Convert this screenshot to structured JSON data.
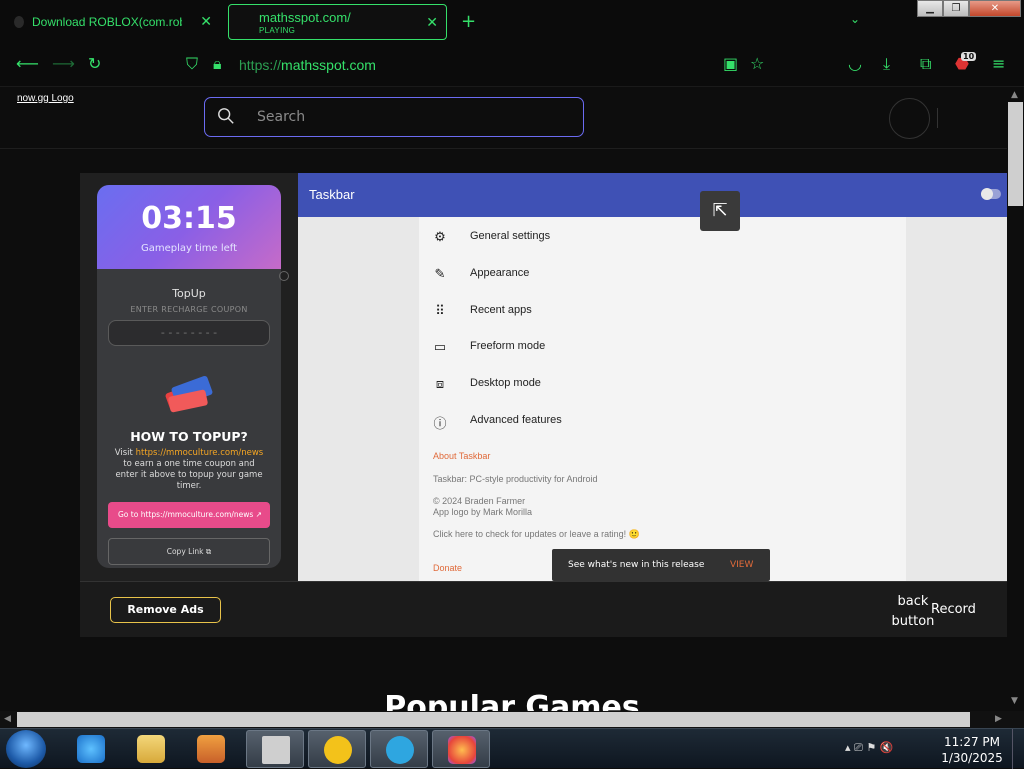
{
  "tabs": [
    {
      "title": "Download ROBLOX(com.roblox",
      "close": "✕"
    },
    {
      "title": "mathsspot.com/",
      "sub": "PLAYING",
      "close": "✕"
    }
  ],
  "newtab": "+",
  "tablist": "⌄",
  "window_controls": {
    "min": "▁",
    "max": "❐",
    "close": "✕"
  },
  "nav": {
    "url_prefix": "https://",
    "url_host": "mathsspot.com",
    "badge": "10"
  },
  "page": {
    "logo": "now.gg Logo",
    "search_placeholder": "Search"
  },
  "game": {
    "timer": "03:15",
    "timer_label": "Gameplay time left",
    "topup_title": "TopUp",
    "coupon_label": "ENTER RECHARGE COUPON",
    "coupon_placeholder": "- - - - - - - -",
    "howto_title": "HOW TO TOPUP?",
    "visit_1": "Visit ",
    "visit_link": "https://mmoculture.com/news",
    "visit_2": " to earn a one time coupon and enter it above to topup your game timer.",
    "go_button": "Go to https://mmoculture.com/news  ↗",
    "copy_button": "Copy Link ⧉",
    "app_title": "Taskbar",
    "menu": [
      {
        "icon": "⚙",
        "label": "General settings"
      },
      {
        "icon": "✎",
        "label": "Appearance"
      },
      {
        "icon": "⠿",
        "label": "Recent apps"
      },
      {
        "icon": "▭",
        "label": "Freeform mode"
      },
      {
        "icon": "⧈",
        "label": "Desktop mode"
      },
      {
        "icon": "ⓘ",
        "label": "Advanced features"
      }
    ],
    "about_header": "About Taskbar",
    "about_desc": "Taskbar: PC-style productivity for Android",
    "copyright_1": "© 2024 Braden Farmer",
    "copyright_2": "App logo by Mark Morilla",
    "rating": "Click here to check for updates or leave a rating! 🙂",
    "donate": "Donate",
    "snackbar_msg": "See what's new in this release",
    "snackbar_action": "VIEW",
    "remove_ads": "Remove Ads",
    "back_button": "back button",
    "record": "Record"
  },
  "popular": "Popular Games",
  "taskbar": {
    "time": "11:27 PM",
    "date": "1/30/2025",
    "tray": "▴ ⎚ ⚑ 🔇"
  },
  "colors": {
    "accent": "#35e06a",
    "appbar": "#3f51b5",
    "search_border": "#6b6bf2",
    "go_button": "#e84b8a"
  }
}
